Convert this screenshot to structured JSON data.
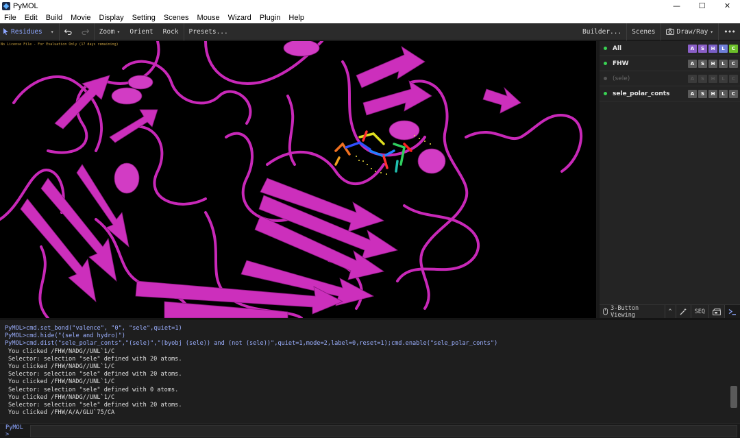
{
  "window": {
    "title": "PyMOL",
    "controls": {
      "minimize": "—",
      "maximize": "☐",
      "close": "✕"
    }
  },
  "menu": [
    "File",
    "Edit",
    "Build",
    "Movie",
    "Display",
    "Setting",
    "Scenes",
    "Mouse",
    "Wizard",
    "Plugin",
    "Help"
  ],
  "toolbar": {
    "selection_mode": "Residues",
    "zoom": "Zoom",
    "orient": "Orient",
    "rock": "Rock",
    "presets": "Presets...",
    "builder": "Builder...",
    "scenes": "Scenes",
    "draw_ray": "Draw/Ray",
    "more": "•••"
  },
  "viewport": {
    "license_notice": "No License File - For Evaluation Only (17 days remaining)",
    "cartoon_color": "#c828b8"
  },
  "objects": [
    {
      "name": "All",
      "enabled": true,
      "style": "all"
    },
    {
      "name": "FHW",
      "enabled": true,
      "style": "normal"
    },
    {
      "name": "(sele)",
      "enabled": false,
      "style": "dim"
    },
    {
      "name": "sele_polar_conts",
      "enabled": true,
      "style": "normal"
    }
  ],
  "object_buttons": [
    "A",
    "S",
    "H",
    "L",
    "C"
  ],
  "panel_footer": {
    "mouse_mode": "3-Button Viewing",
    "expand": "^",
    "seq": "SEQ"
  },
  "console": {
    "lines": [
      {
        "type": "cmd",
        "text": "PyMOL>cmd.set_bond(\"valence\", \"0\", \"sele\",quiet=1)"
      },
      {
        "type": "cmd",
        "text": "PyMOL>cmd.hide(\"(sele and hydro)\")"
      },
      {
        "type": "cmd",
        "text": "PyMOL>cmd.dist(\"sele_polar_conts\",\"(sele)\",\"(byobj (sele)) and (not (sele))\",quiet=1,mode=2,label=0,reset=1);cmd.enable(\"sele_polar_conts\")"
      },
      {
        "type": "out",
        "text": "You clicked /FHW/NADG//UNL`1/C"
      },
      {
        "type": "out",
        "text": "Selector: selection \"sele\" defined with 20 atoms."
      },
      {
        "type": "out",
        "text": "You clicked /FHW/NADG//UNL`1/C"
      },
      {
        "type": "out",
        "text": "Selector: selection \"sele\" defined with 20 atoms."
      },
      {
        "type": "out",
        "text": "You clicked /FHW/NADG//UNL`1/C"
      },
      {
        "type": "out",
        "text": "Selector: selection \"sele\" defined with 0 atoms."
      },
      {
        "type": "out",
        "text": "You clicked /FHW/NADG//UNL`1/C"
      },
      {
        "type": "out",
        "text": "Selector: selection \"sele\" defined with 20 atoms."
      },
      {
        "type": "out",
        "text": "You clicked /FHW/A/A/GLU`75/CA"
      }
    ]
  },
  "command": {
    "prompt": "PyMOL >",
    "value": ""
  }
}
